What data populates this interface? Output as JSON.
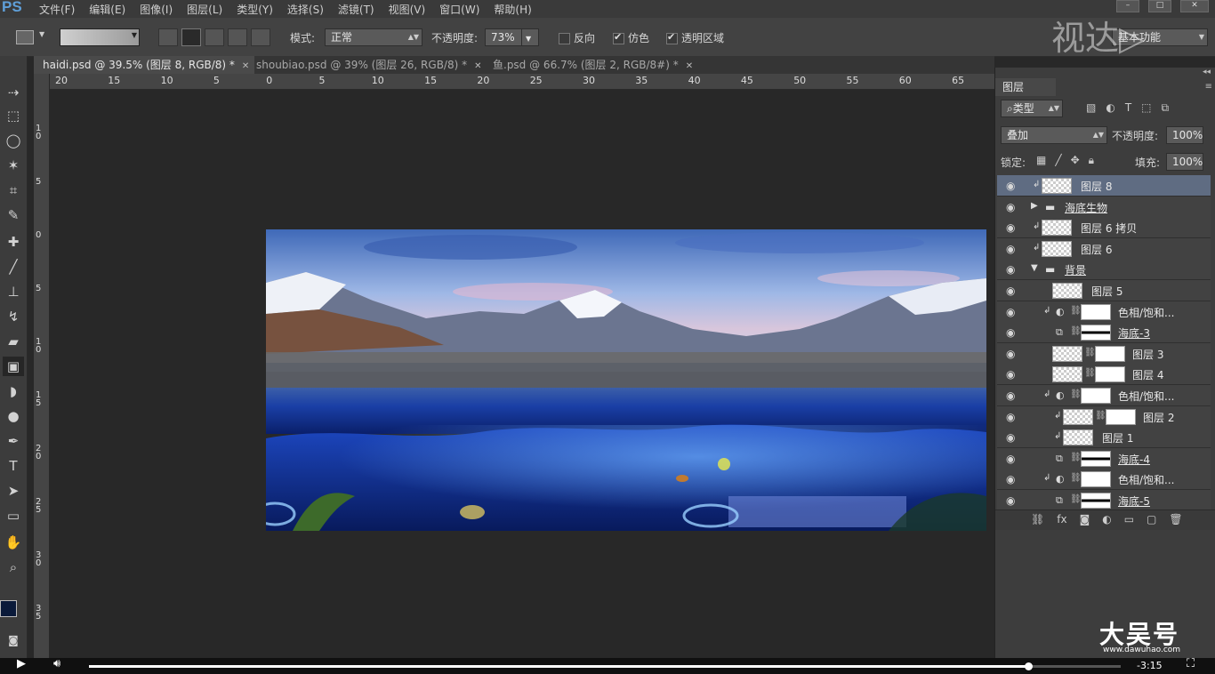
{
  "app": {
    "logo": "PS",
    "menu": [
      "文件(F)",
      "编辑(E)",
      "图像(I)",
      "图层(L)",
      "类型(Y)",
      "选择(S)",
      "滤镜(T)",
      "视图(V)",
      "窗口(W)",
      "帮助(H)"
    ],
    "workspace": "基本功能",
    "watermark_top": "视达▷",
    "watermark_bottom": "大吴号",
    "watermark_bottom_sub": "www.dawuhao.com"
  },
  "options": {
    "mode_label": "模式:",
    "mode_value": "正常",
    "opacity_label": "不透明度:",
    "opacity_value": "73%",
    "reverse_label": "反向",
    "dither_label": "仿色",
    "transparency_label": "透明区域",
    "reverse_checked": false,
    "dither_checked": true,
    "transparency_checked": true
  },
  "tabs": [
    {
      "label": "haidi.psd @ 39.5% (图层 8, RGB/8) *",
      "active": true
    },
    {
      "label": "shoubiao.psd @ 39% (图层 26, RGB/8) *",
      "active": false
    },
    {
      "label": "鱼.psd @ 66.7% (图层 2, RGB/8#) *",
      "active": false
    }
  ],
  "ruler": {
    "h_labels": [
      "20",
      "15",
      "10",
      "5",
      "0",
      "5",
      "10",
      "15",
      "20",
      "25",
      "30",
      "35",
      "40",
      "45",
      "50",
      "55",
      "60",
      "65"
    ],
    "v_labels": [
      "1 0",
      "5",
      "0",
      "5",
      "1 0",
      "1 5",
      "2 0",
      "2 5",
      "3 0",
      "3 5"
    ]
  },
  "layers_panel": {
    "title": "图层",
    "filter_label": "类型",
    "blend_mode": "叠加",
    "opacity_label": "不透明度:",
    "opacity_value": "100%",
    "lock_label": "锁定:",
    "fill_label": "填充:",
    "fill_value": "100%",
    "layers": [
      {
        "name": "图层 8",
        "kind": "pixel",
        "clip": true,
        "selected": true,
        "indent": 0
      },
      {
        "name": "海底生物",
        "kind": "group-collapsed",
        "indent": 0
      },
      {
        "name": "图层 6 拷贝",
        "kind": "pixel",
        "clip": true,
        "indent": 0
      },
      {
        "name": "图层 6",
        "kind": "pixel",
        "clip": true,
        "indent": 0
      },
      {
        "name": "背景",
        "kind": "group-open",
        "indent": 0
      },
      {
        "name": "图层 5",
        "kind": "pixel",
        "indent": 1
      },
      {
        "name": "色相/饱和...",
        "kind": "adjust",
        "clip": true,
        "indent": 1
      },
      {
        "name": "海底-3",
        "kind": "smart-mask",
        "indent": 1
      },
      {
        "name": "图层 3",
        "kind": "pixel-mask",
        "indent": 1
      },
      {
        "name": "图层 4",
        "kind": "pixel-mask",
        "indent": 1
      },
      {
        "name": "色相/饱和...",
        "kind": "adjust",
        "clip": true,
        "indent": 1
      },
      {
        "name": "图层 2",
        "kind": "pixel-mask",
        "clip": true,
        "indent": 2
      },
      {
        "name": "图层 1",
        "kind": "pixel",
        "clip": true,
        "indent": 2
      },
      {
        "name": "海底-4",
        "kind": "smart-mask",
        "indent": 1
      },
      {
        "name": "色相/饱和...",
        "kind": "adjust",
        "clip": true,
        "indent": 1
      },
      {
        "name": "海底-5",
        "kind": "smart-mask",
        "indent": 1
      }
    ]
  },
  "player": {
    "time": "-3:15",
    "progress": 0.91
  },
  "colors": {
    "accent": "#5f6c82",
    "foreground": "#0a1a3a",
    "background": "#3a2a10"
  }
}
